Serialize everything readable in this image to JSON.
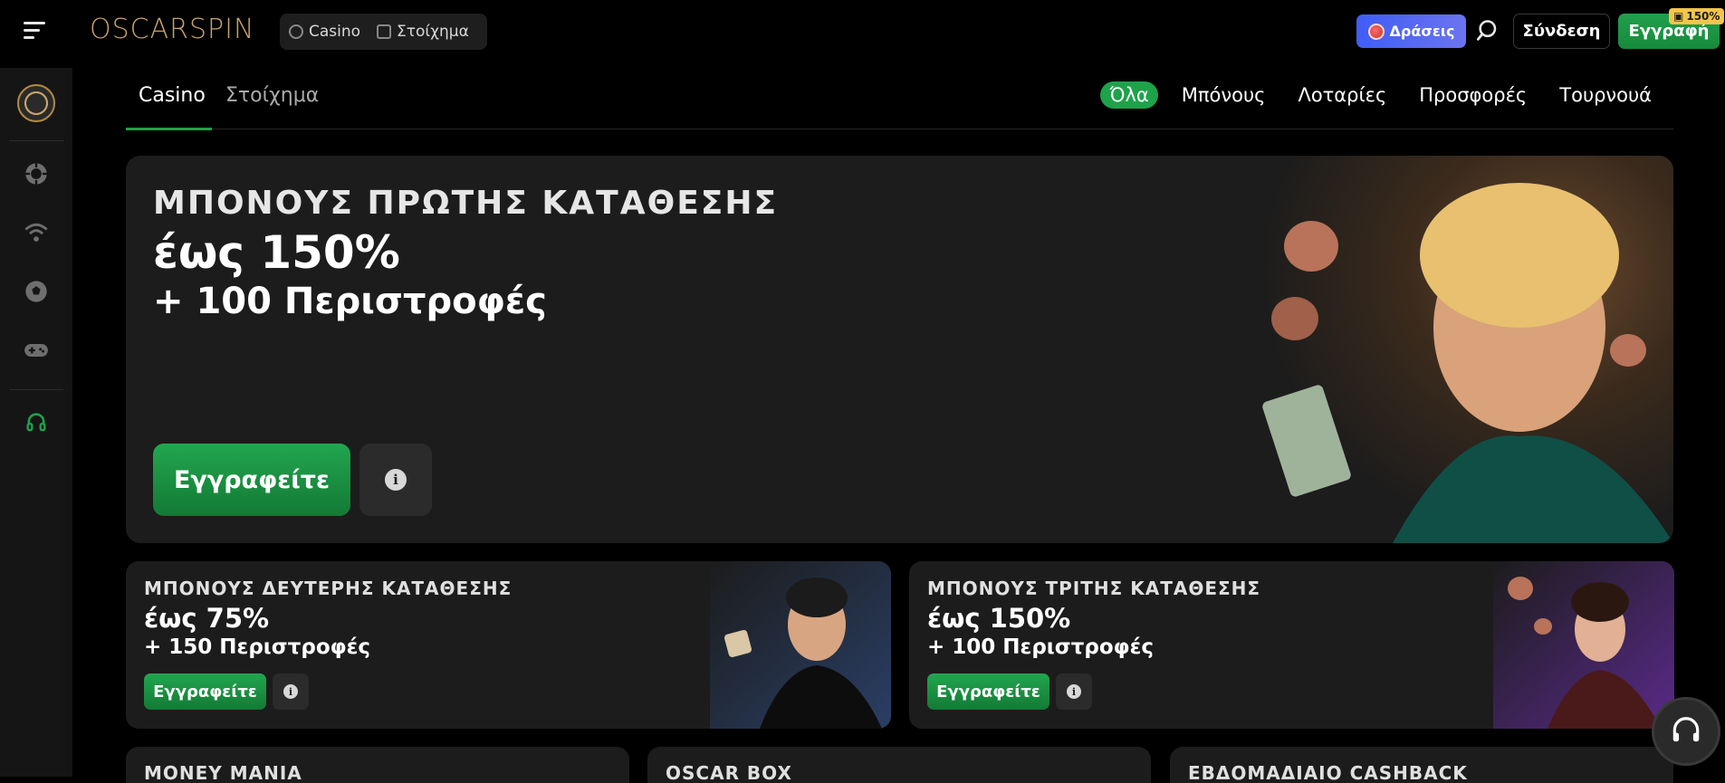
{
  "header": {
    "logo": "OSCARSPIN",
    "switch": [
      {
        "label": "Casino"
      },
      {
        "label": "Στοίχημα"
      }
    ],
    "actions_label": "Δράσεις",
    "login_label": "Σύνδεση",
    "register_label": "Εγγραφή",
    "register_badge": "150%"
  },
  "tabs": {
    "casino": "Casino",
    "bet": "Στοίχημα"
  },
  "filters": [
    "Όλα",
    "Μπόνους",
    "Λοταρίες",
    "Προσφορές",
    "Τουρνουά"
  ],
  "hero": {
    "title": "ΜΠΟΝΟΥΣ ΠΡΩΤΗΣ ΚΑΤΑΘΕΣΗΣ",
    "amount": "έως 150%",
    "spins": "+ 100 Περιστροφές",
    "cta": "Εγγραφείτε"
  },
  "cards": [
    {
      "title": "ΜΠΟΝΟΥΣ ΔΕΥΤΕΡΗΣ ΚΑΤΑΘΕΣΗΣ",
      "amount": "έως 75%",
      "spins": "+ 150 Περιστροφές",
      "cta": "Εγγραφείτε"
    },
    {
      "title": "ΜΠΟΝΟΥΣ ΤΡΙΤΗΣ ΚΑΤΑΘΕΣΗΣ",
      "amount": "έως 150%",
      "spins": "+ 100 Περιστροφές",
      "cta": "Εγγραφείτε"
    }
  ],
  "mini_cards": [
    "MONEY MANIA",
    "OSCAR BOX",
    "ΕΒΔΟΜΑΔΙΑΙΟ CASHBACK"
  ],
  "colors": {
    "accent": "#1ea24a",
    "actions": "#3f5df5",
    "gold": "#c9a46a"
  }
}
